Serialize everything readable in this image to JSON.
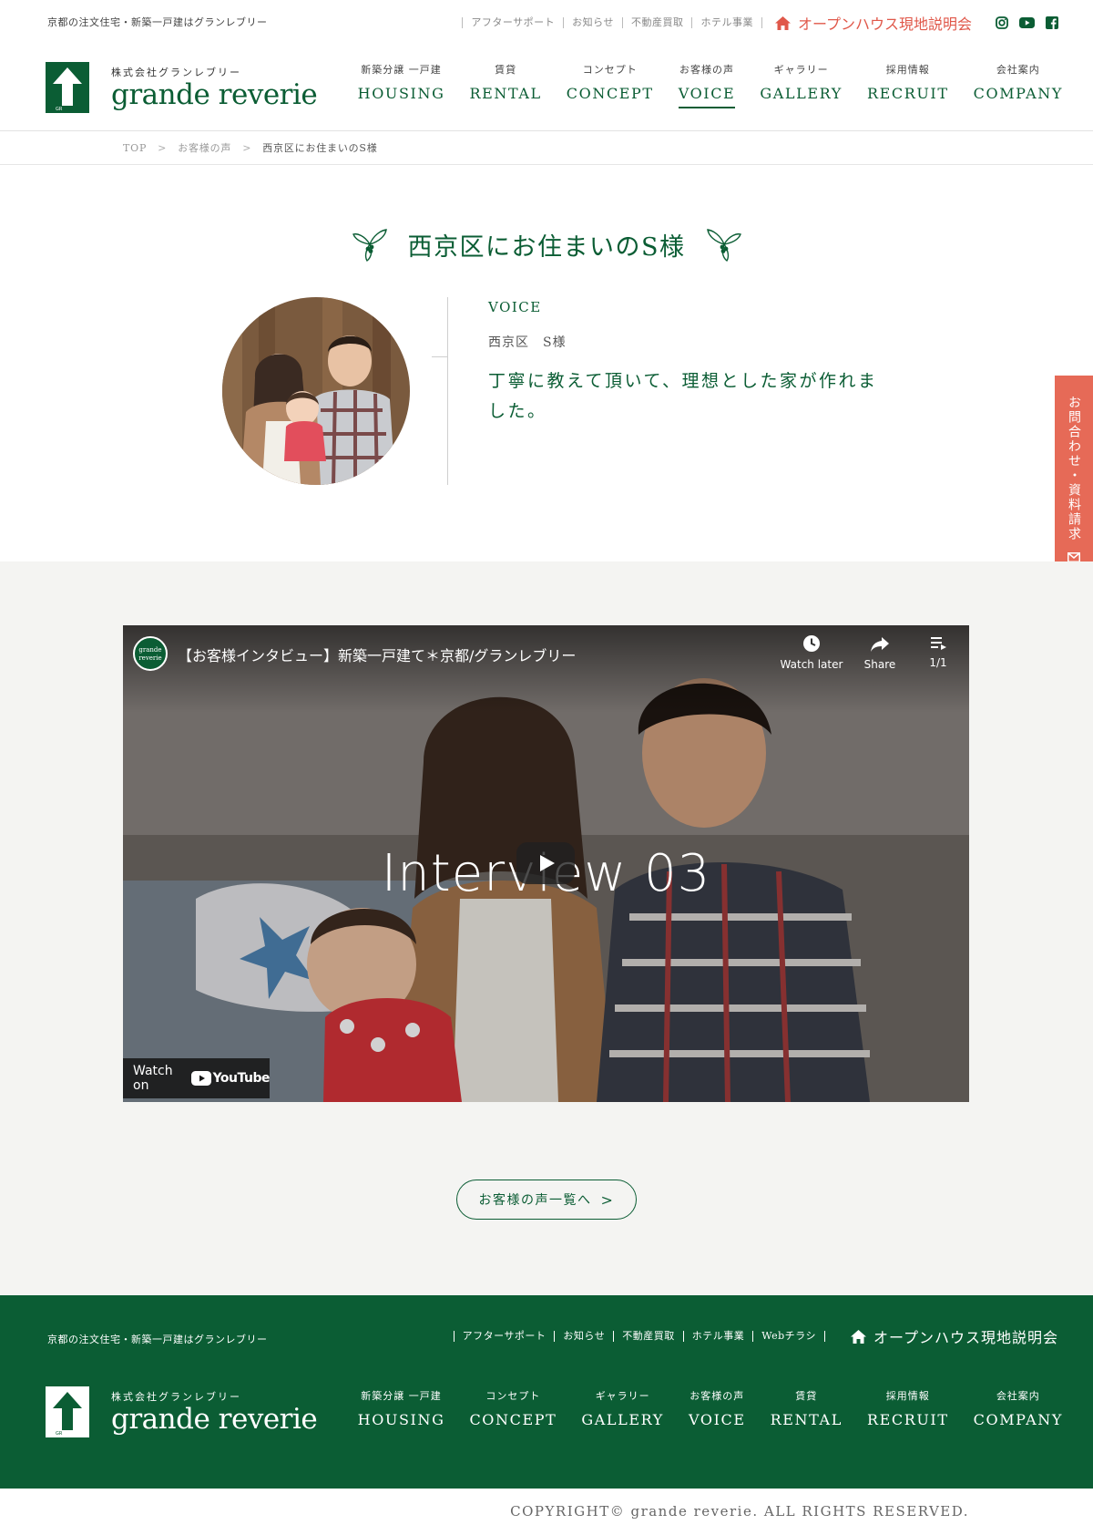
{
  "header": {
    "tagline": "京都の注文住宅・新築一戸建はグランレブリー",
    "util_links": [
      "アフターサポート",
      "お知らせ",
      "不動産買取",
      "ホテル事業"
    ],
    "openhouse_label": "オープンハウス現地説明会",
    "sns": [
      "instagram-icon",
      "youtube-icon",
      "facebook-icon"
    ],
    "logo_sub": "株式会社グランレブリー",
    "logo_main": "grande reverie",
    "logo_mark_letters": "GR",
    "nav": [
      {
        "jp": "新築分譲 一戸建",
        "en": "HOUSING"
      },
      {
        "jp": "賃貸",
        "en": "RENTAL"
      },
      {
        "jp": "コンセプト",
        "en": "CONCEPT"
      },
      {
        "jp": "お客様の声",
        "en": "VOICE",
        "active": true
      },
      {
        "jp": "ギャラリー",
        "en": "GALLERY"
      },
      {
        "jp": "採用情報",
        "en": "RECRUIT"
      },
      {
        "jp": "会社案内",
        "en": "COMPANY"
      }
    ]
  },
  "breadcrumb": {
    "items": [
      "TOP",
      "お客様の声"
    ],
    "current": "西京区にお住まいのS様",
    "separator": ">"
  },
  "profile": {
    "title": "西京区にお住まいのS様",
    "label": "VOICE",
    "name": "西京区　S様",
    "quote": "丁寧に教えて頂いて、理想とした家が作れました。"
  },
  "video": {
    "title": "【お客様インタビュー】新築一戸建て＊京都/グランレブリー",
    "channel_name_line1": "grande",
    "channel_name_line2": "reverie",
    "actions": [
      {
        "icon": "clock-icon",
        "label": "Watch later"
      },
      {
        "icon": "share-icon",
        "label": "Share"
      },
      {
        "icon": "playlist-icon",
        "label": "1/1"
      }
    ],
    "overlay_title": "Interview 03",
    "watch_on": "Watch on",
    "youtube_label": "YouTube"
  },
  "list_button": {
    "label": "お客様の声一覧へ",
    "chevron": ">"
  },
  "side_tab": {
    "label": "お問合わせ・資料請求"
  },
  "footer": {
    "tagline": "京都の注文住宅・新築一戸建はグランレブリー",
    "util_links": [
      "アフターサポート",
      "お知らせ",
      "不動産買取",
      "ホテル事業",
      "Webチラシ"
    ],
    "openhouse_label": "オープンハウス現地説明会",
    "logo_sub": "株式会社グランレブリー",
    "logo_main": "grande reverie",
    "nav": [
      {
        "jp": "新築分譲 一戸建",
        "en": "HOUSING"
      },
      {
        "jp": "コンセプト",
        "en": "CONCEPT"
      },
      {
        "jp": "ギャラリー",
        "en": "GALLERY"
      },
      {
        "jp": "お客様の声",
        "en": "VOICE"
      },
      {
        "jp": "賃貸",
        "en": "RENTAL"
      },
      {
        "jp": "採用情報",
        "en": "RECRUIT"
      },
      {
        "jp": "会社案内",
        "en": "COMPANY"
      }
    ],
    "copyright": "COPYRIGHT© grande reverie. ALL RIGHTS RESERVED."
  },
  "colors": {
    "brand_green": "#0b5d34",
    "accent_red": "#e0584a",
    "side_tab": "#e66a57"
  }
}
